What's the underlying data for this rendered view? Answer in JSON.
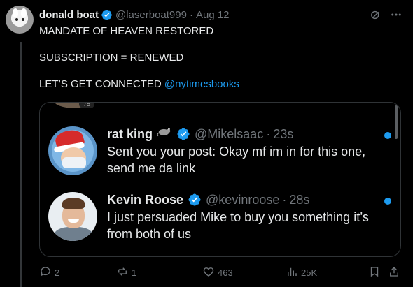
{
  "tweet": {
    "author_name": "donald boat",
    "author_handle": "@laserboat999",
    "separator": "·",
    "date": "Aug 12",
    "lines": [
      "MANDATE OF HEAVEN RESTORED",
      "",
      "SUBSCRIPTION = RENEWED",
      "",
      "LET’S GET CONNECTED "
    ],
    "mention": "@nytimesbooks"
  },
  "media": {
    "peek_badge": "75",
    "messages": [
      {
        "name": "rat king",
        "emoji_icon": "rat-icon",
        "handle": "@Mikelsaac",
        "time": "23s",
        "text": "Sent you your post: Okay mf im in for this one, send me da link"
      },
      {
        "name": "Kevin Roose",
        "handle": "@kevinroose",
        "time": "28s",
        "text": "I just persuaded Mike to buy you something it’s from both of us"
      }
    ]
  },
  "actions": {
    "replies": "2",
    "reposts": "1",
    "likes": "463",
    "views": "25K"
  },
  "colors": {
    "accent": "#1d9bf0",
    "muted": "#71767b",
    "text": "#e7e9ea",
    "background": "#000000"
  }
}
